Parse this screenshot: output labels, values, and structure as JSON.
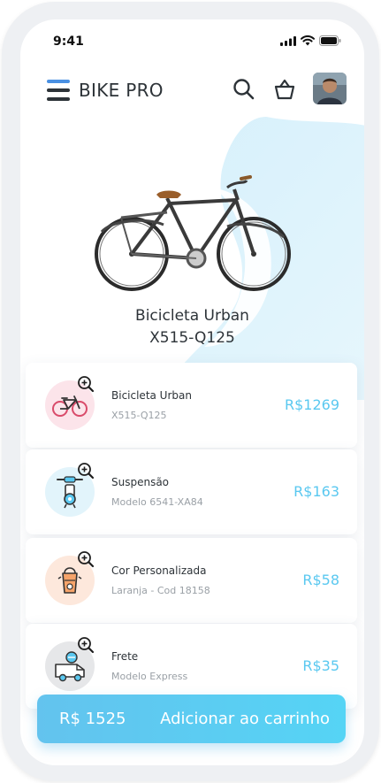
{
  "status_bar": {
    "time": "9:41"
  },
  "header": {
    "brand": "BIKE PRO"
  },
  "product": {
    "name": "Bicicleta Urban",
    "code": "X515-Q125"
  },
  "items": [
    {
      "title": "Bicicleta Urban",
      "subtitle": "X515-Q125",
      "price": "R$1269",
      "icon": "bicycle-icon",
      "circle_color": "#fce4ea"
    },
    {
      "title": "Suspensão",
      "subtitle": "Modelo 6541-XA84",
      "price": "R$163",
      "icon": "suspension-icon",
      "circle_color": "#e2f4fb"
    },
    {
      "title": "Cor Personalizada",
      "subtitle": "Laranja - Cod 18158",
      "price": "R$58",
      "icon": "paint-bucket-icon",
      "circle_color": "#fde8dc"
    },
    {
      "title": "Frete",
      "subtitle": "Modelo Express",
      "price": "R$35",
      "icon": "delivery-truck-icon",
      "circle_color": "#e6e7e9"
    }
  ],
  "cart": {
    "total": "R$  1525",
    "button_label": "Adicionar ao carrinho"
  },
  "colors": {
    "accent": "#5ac8f0",
    "menu_blue": "#4a90e2",
    "text_dark": "#2d3338"
  }
}
